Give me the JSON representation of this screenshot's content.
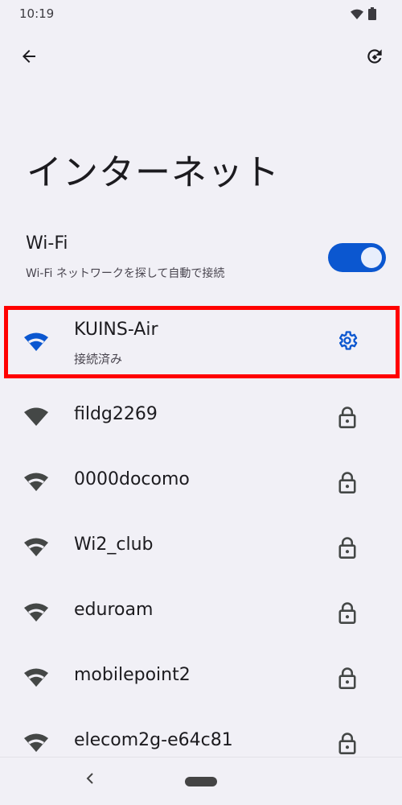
{
  "status_bar": {
    "time": "10:19",
    "icons": [
      "wifi-icon",
      "battery-icon"
    ]
  },
  "top_bar": {
    "back_icon": "arrow-back-icon",
    "refresh_icon": "refresh-icon"
  },
  "title": "インターネット",
  "wifi": {
    "label": "Wi-Fi",
    "subtitle": "Wi-Fi ネットワークを探して自動で接続",
    "enabled": true,
    "accent": "#0b57d0"
  },
  "connected_network": {
    "name": "KUINS-Air",
    "status": "接続済み",
    "icon": "wifi-signal-icon",
    "action_icon": "gear-icon",
    "color": "#0b57d0"
  },
  "networks": [
    {
      "name": "fildg2269",
      "icon": "wifi-signal-icon",
      "secured": true
    },
    {
      "name": "0000docomo",
      "icon": "wifi-signal-icon",
      "secured": true
    },
    {
      "name": "Wi2_club",
      "icon": "wifi-signal-icon",
      "secured": true
    },
    {
      "name": "eduroam",
      "icon": "wifi-signal-icon",
      "secured": true
    },
    {
      "name": "mobilepoint2",
      "icon": "wifi-signal-icon",
      "secured": true
    },
    {
      "name": "elecom2g-e64c81",
      "icon": "wifi-signal-icon",
      "secured": true
    }
  ],
  "nav_bar": {
    "back_icon": "nav-back-icon",
    "home_icon": "home-pill-icon"
  },
  "highlight_color": "#ff0000"
}
